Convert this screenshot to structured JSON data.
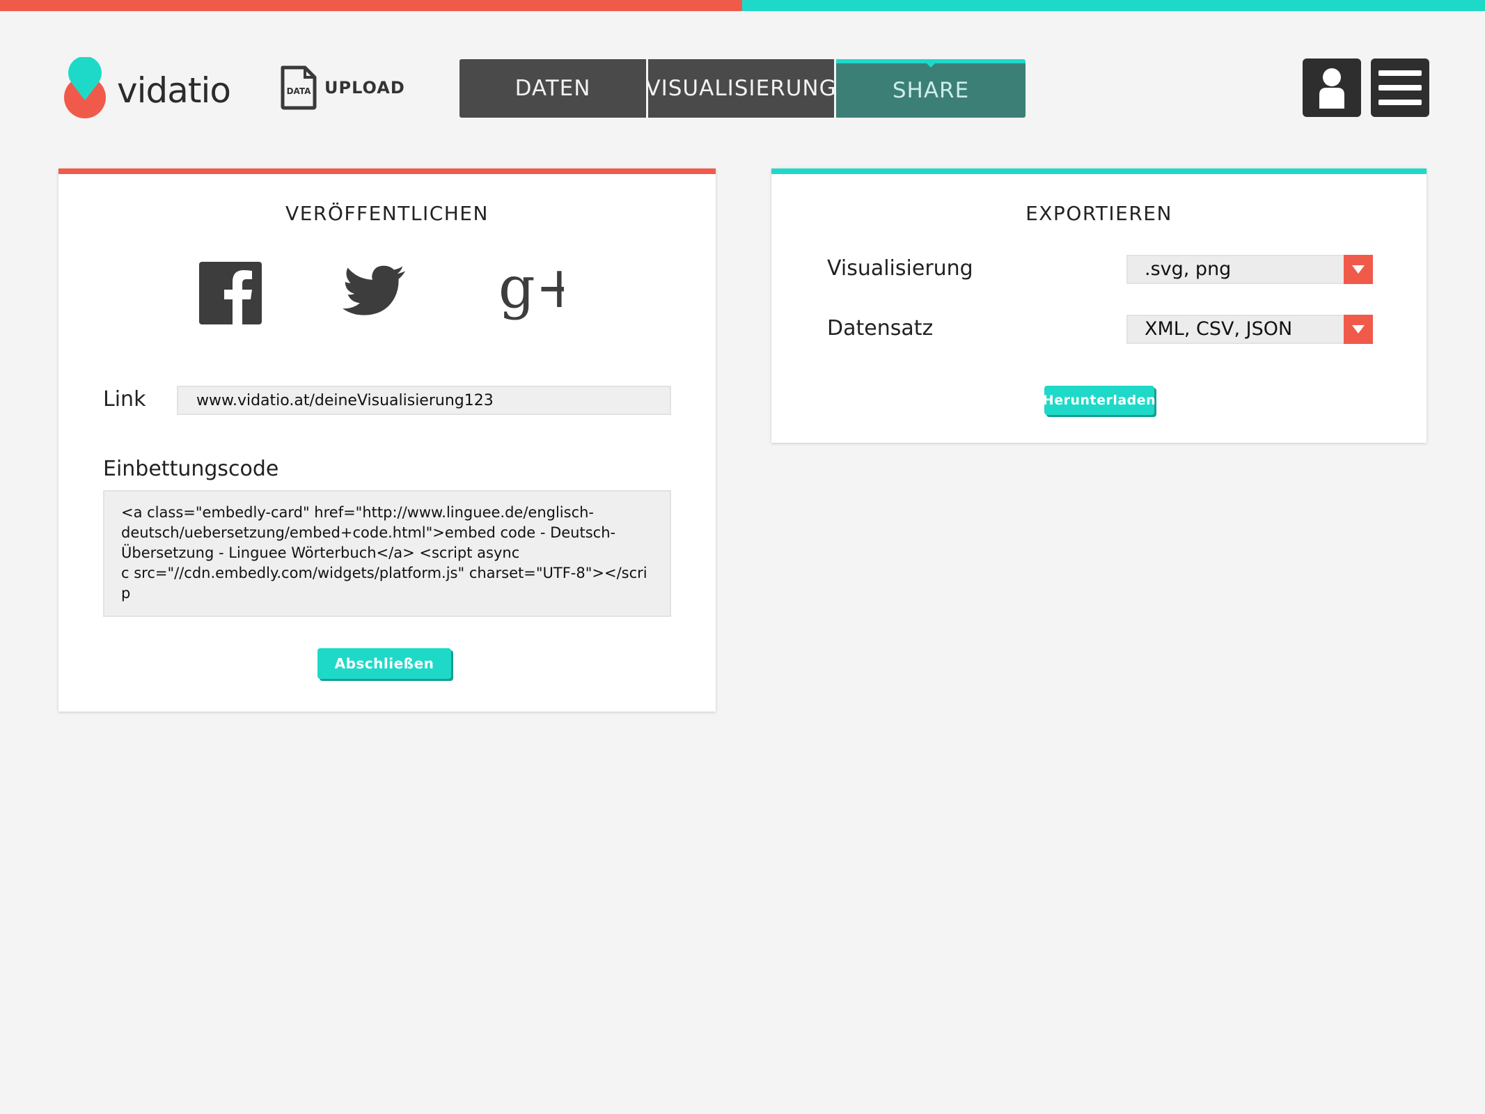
{
  "colors": {
    "accent_red": "#f05a4a",
    "accent_teal": "#1fd9c8",
    "tab_dark": "#4a4a4a",
    "tab_active": "#3c7f77"
  },
  "header": {
    "logo_text": "vidatio",
    "upload_icon_text": "DATA",
    "upload_label": "UPLOAD",
    "tabs": [
      {
        "label": "DATEN",
        "active": false
      },
      {
        "label": "VISUALISIERUNG",
        "active": false
      },
      {
        "label": "SHARE",
        "active": true
      }
    ],
    "user_icon": "user-icon",
    "menu_icon": "hamburger-menu-icon"
  },
  "publish": {
    "title": "VERÖFFENTLICHEN",
    "social": [
      "facebook-icon",
      "twitter-icon",
      "google-plus-icon"
    ],
    "gplus_text": "g+",
    "link_label": "Link",
    "link_value": "www.vidatio.at/deineVisualisierung123",
    "embed_label": "Einbettungscode",
    "embed_value": "<a class=\"embedly-card\" href=\"http://www.linguee.de/englisch-\ndeutsch/uebersetzung/embed+code.html\">embed code - Deutsch-\nÜbersetzung - Linguee Wörterbuch</a> <script async\nc src=\"//cdn.embedly.com/widgets/platform.js\" charset=\"UTF-8\"></scrip",
    "finish_button": "Abschließen"
  },
  "export": {
    "title": "EXPORTIEREN",
    "vis_label": "Visualisierung",
    "vis_value": ".svg, png",
    "data_label": "Datensatz",
    "data_value": "XML, CSV, JSON",
    "download_button": "Herunterladen"
  }
}
